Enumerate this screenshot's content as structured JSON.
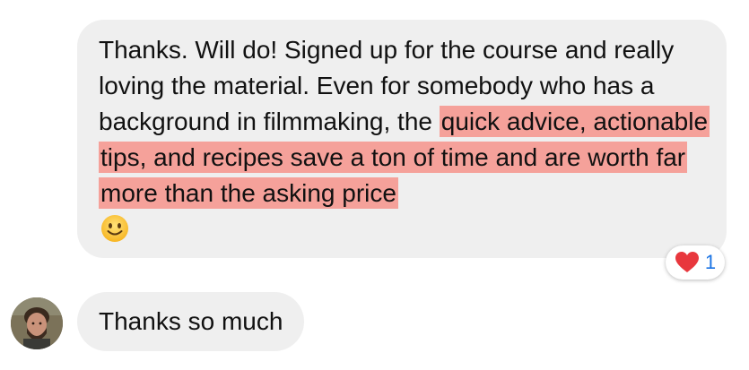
{
  "colors": {
    "bubble": "#efefef",
    "highlight": "#f5a19a",
    "heart": "#e8373d",
    "count": "#1b74e4"
  },
  "message": {
    "text_plain": "Thanks. Will do! Signed up for the course and really loving the material. Even for somebody who has a background in filmmaking, the ",
    "text_highlight": "quick advice, actionable tips, and recipes save a ton of time and are worth far more than the asking price",
    "emoji": "slightly-smiling-face"
  },
  "reaction": {
    "icon": "heart-icon",
    "count": "1"
  },
  "reply": {
    "text": "Thanks so much"
  }
}
